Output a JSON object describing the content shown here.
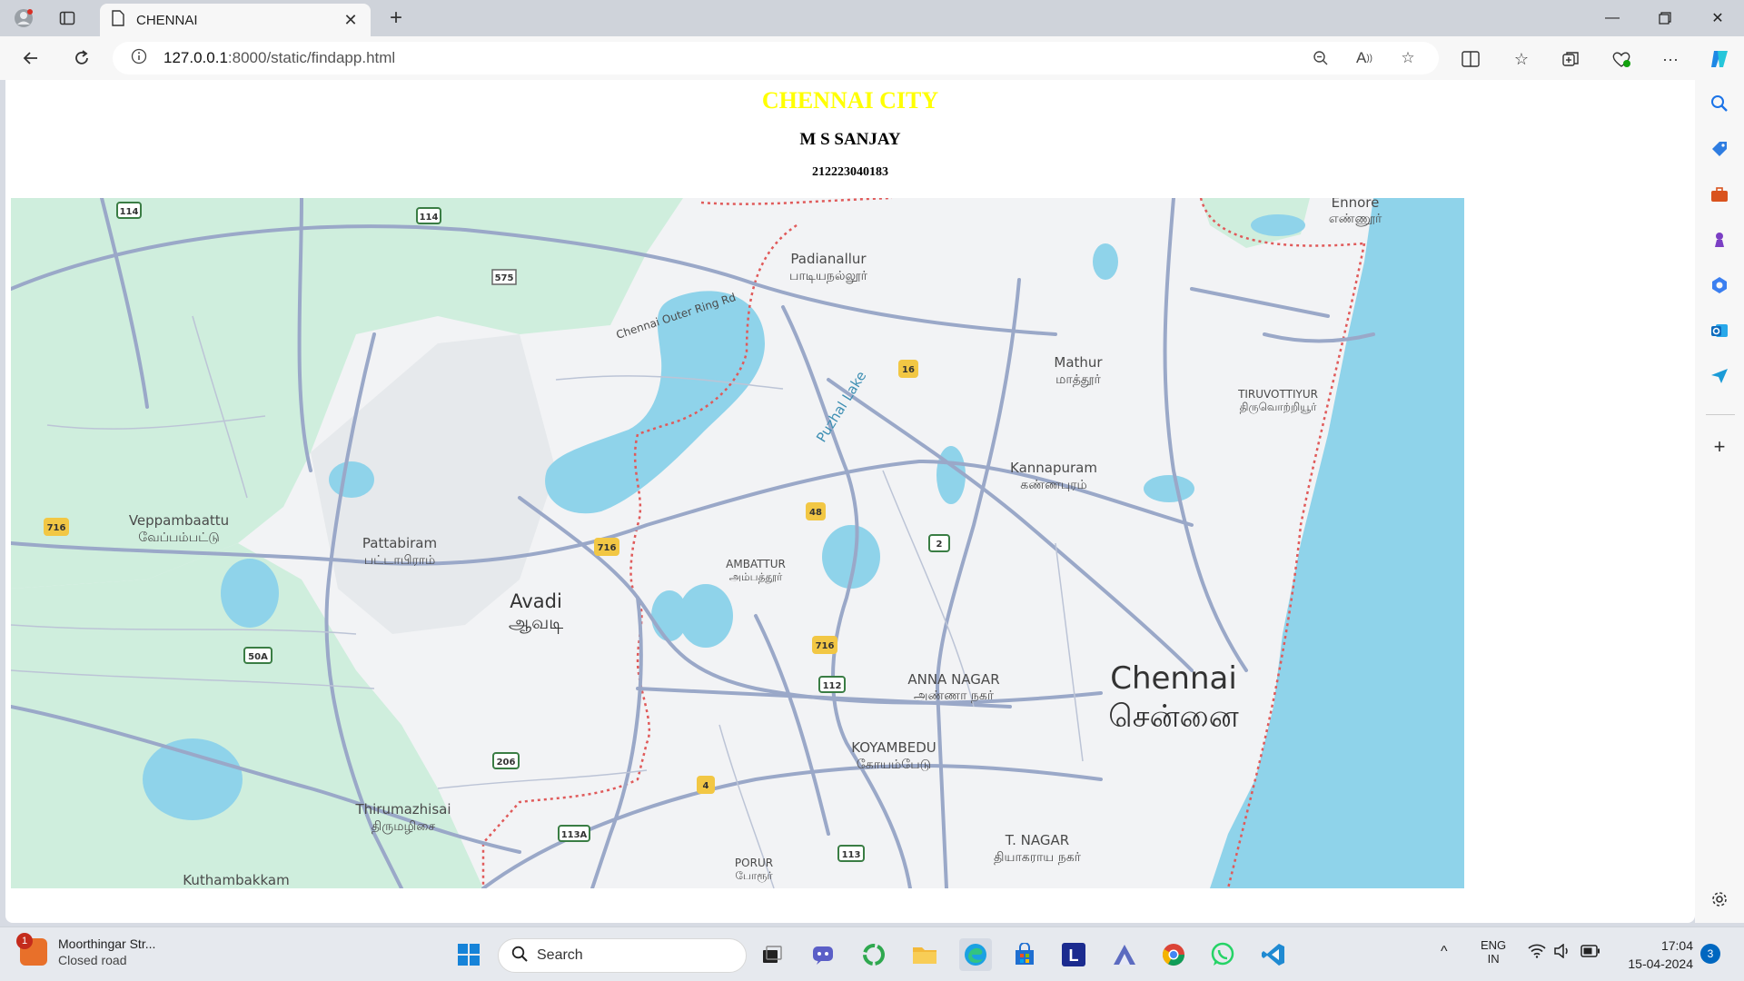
{
  "browser": {
    "tab_title": "CHENNAI",
    "url_host": "127.0.0.1",
    "url_rest": ":8000/static/findapp.html"
  },
  "page": {
    "city_title": "CHENNAI CITY",
    "author": "M S SANJAY",
    "reg_no": "212223040183"
  },
  "map": {
    "places": [
      {
        "en": "Ennore",
        "ta": "எண்ணூர்"
      },
      {
        "en": "Padianallur",
        "ta": "பாடியநல்லூர்"
      },
      {
        "en": "Mathur",
        "ta": "மாத்தூர்"
      },
      {
        "en": "TIRUVOTTIYUR",
        "ta": "திருவொற்றியூர்"
      },
      {
        "en": "Kannapuram",
        "ta": "கண்ணபுரம்"
      },
      {
        "en": "Veppambaattu",
        "ta": "வேப்பம்பட்டு"
      },
      {
        "en": "Pattabiram",
        "ta": "பட்டாபிராம்"
      },
      {
        "en": "AMBATTUR",
        "ta": "அம்பத்தூர்"
      },
      {
        "en": "Avadi",
        "ta": "ஆவடி"
      },
      {
        "en": "ANNA NAGAR",
        "ta": "அண்ணா நகர்"
      },
      {
        "en": "Chennai",
        "ta": "சென்னை"
      },
      {
        "en": "KOYAMBEDU",
        "ta": "கோயம்பேடு"
      },
      {
        "en": "Thirumazhisai",
        "ta": "திருமழிசை"
      },
      {
        "en": "T. NAGAR",
        "ta": "தியாகராய நகர்"
      },
      {
        "en": "PORUR",
        "ta": "போரூர்"
      },
      {
        "en": "Kuthambakkam",
        "ta": ""
      }
    ],
    "lake": "Puzhal Lake",
    "ring_road": "Chennai Outer Ring Rd",
    "shields": [
      "114",
      "114",
      "575",
      "16",
      "48",
      "2",
      "716",
      "716",
      "716",
      "50A",
      "112",
      "206",
      "4",
      "113A",
      "113"
    ]
  },
  "taskbar": {
    "weather_title": "Moorthingar Str...",
    "weather_sub": "Closed road",
    "weather_badge": "1",
    "search_label": "Search",
    "lang_top": "ENG",
    "lang_bottom": "IN",
    "time": "17:04",
    "date": "15-04-2024",
    "notifications": "3"
  }
}
